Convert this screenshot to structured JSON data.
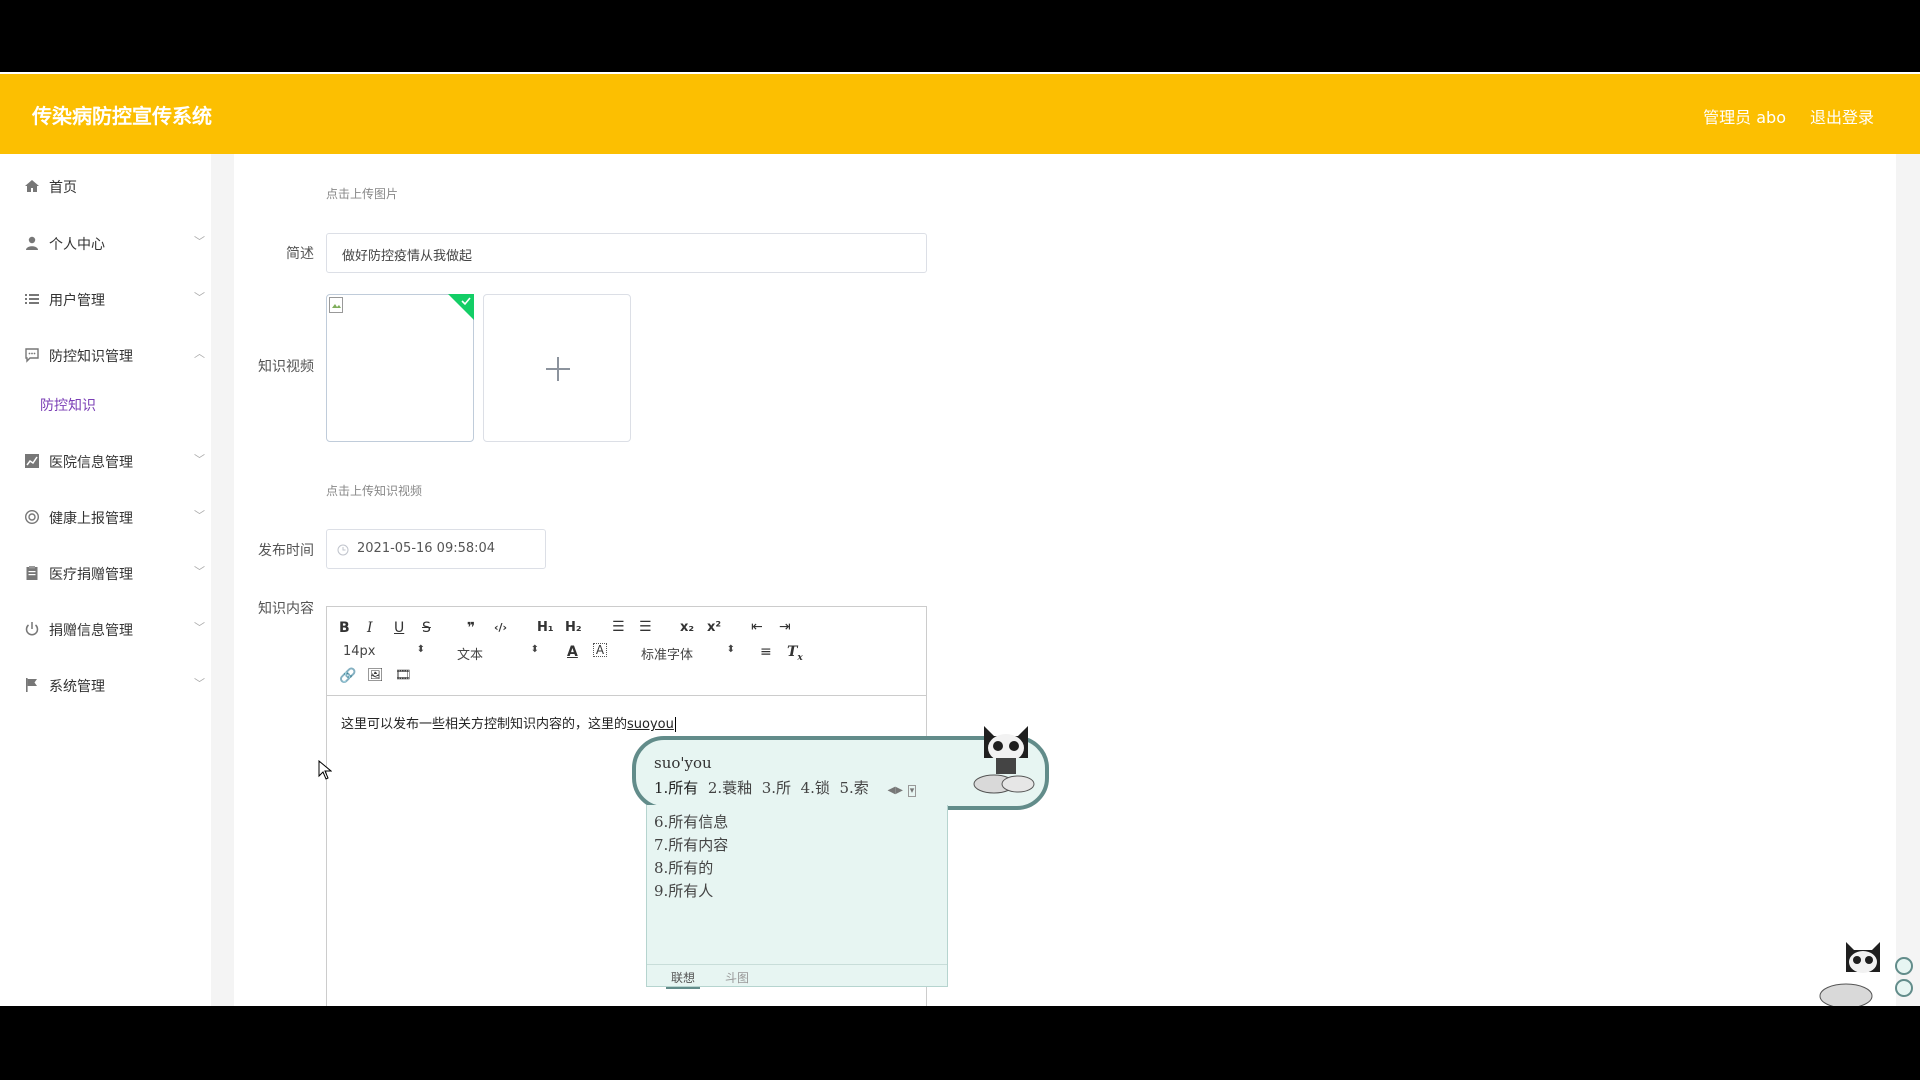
{
  "header": {
    "title": "传染病防控宣传系统",
    "user": "管理员 abo",
    "logout": "退出登录"
  },
  "sidebar": {
    "items": [
      {
        "label": "首页",
        "icon": "home-icon"
      },
      {
        "label": "个人中心",
        "icon": "user-icon"
      },
      {
        "label": "用户管理",
        "icon": "list-icon"
      },
      {
        "label": "防控知识管理",
        "icon": "chat-icon"
      },
      {
        "label": "医院信息管理",
        "icon": "chart-icon"
      },
      {
        "label": "健康上报管理",
        "icon": "lifebuoy-icon"
      },
      {
        "label": "医疗捐赠管理",
        "icon": "clipboard-icon"
      },
      {
        "label": "捐赠信息管理",
        "icon": "power-icon"
      },
      {
        "label": "系统管理",
        "icon": "flag-icon"
      }
    ],
    "sub_item": "防控知识"
  },
  "form": {
    "upload_image_hint": "点击上传图片",
    "summary_label": "简述",
    "summary_value": "做好防控疫情从我做起",
    "video_label": "知识视频",
    "upload_video_hint": "点击上传知识视频",
    "publish_label": "发布时间",
    "publish_value": "2021-05-16 09:58:04",
    "content_label": "知识内容"
  },
  "editor": {
    "font_size": "14px",
    "block_type": "文本",
    "font_family": "标准字体",
    "content_text": "这里可以发布一些相关方控制知识内容的，这里的",
    "typed_text": "suoyou"
  },
  "ime": {
    "pinyin": "suo'you",
    "candidates": [
      "1.所有",
      "2.蓑釉",
      "3.所",
      "4.锁",
      "5.索"
    ],
    "more": [
      "6.所有信息",
      "7.所有内容",
      "8.所有的",
      "9.所有人"
    ],
    "tabs": [
      "联想",
      "斗图"
    ]
  }
}
